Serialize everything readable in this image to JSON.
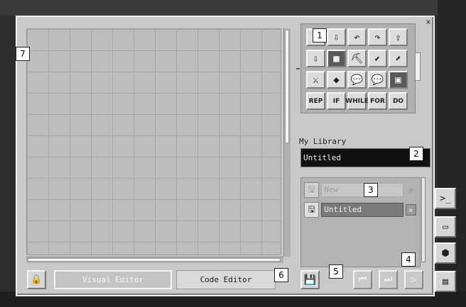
{
  "window": {
    "close_symbol": "×"
  },
  "palette": {
    "rows": [
      [
        {
          "icon": "arrow-up-icon",
          "glyph": "⇧"
        },
        {
          "icon": "arrow-down-icon",
          "glyph": "⇩"
        },
        {
          "icon": "turn-left-icon",
          "glyph": "↶"
        },
        {
          "icon": "turn-right-icon",
          "glyph": "↷"
        },
        {
          "icon": "move-up-icon",
          "glyph": "⇪"
        }
      ],
      [
        {
          "icon": "move-down-icon",
          "glyph": "⇩"
        },
        {
          "icon": "block-icon",
          "glyph": "■"
        },
        {
          "icon": "pickaxe-icon",
          "glyph": "⛏"
        },
        {
          "icon": "dig-down-icon",
          "glyph": "⬋"
        },
        {
          "icon": "dig-up-icon",
          "glyph": "⬈"
        }
      ],
      [
        {
          "icon": "sword-icon",
          "glyph": "⚔"
        },
        {
          "icon": "place-block-icon",
          "glyph": "◆"
        },
        {
          "icon": "speech-bubble-icon",
          "glyph": "💬"
        },
        {
          "icon": "speech-bubble-faded-icon",
          "glyph": "💬"
        },
        {
          "icon": "chest-icon",
          "glyph": "▣"
        }
      ]
    ],
    "keywords": [
      "REP",
      "IF",
      "WHILE",
      "FOR",
      "DO"
    ]
  },
  "library": {
    "label": "My Library",
    "name_value": "Untitled",
    "new_placeholder": "New",
    "add_symbol": "✚",
    "items": [
      {
        "name": "Untitled",
        "delete_symbol": "✕"
      }
    ]
  },
  "editor_tabs": {
    "visual": "Visual Editor",
    "code": "Code Editor"
  },
  "controls": {
    "lock": "🔒",
    "save": "💾",
    "rewind": "⏮",
    "step": "⏭",
    "play": "▷"
  },
  "side_tabs": {
    "terminal": ">_",
    "monitor": "▭",
    "block": "⬢",
    "disk": "▤"
  },
  "callouts": [
    "1",
    "2",
    "3",
    "4",
    "5",
    "6",
    "7"
  ]
}
